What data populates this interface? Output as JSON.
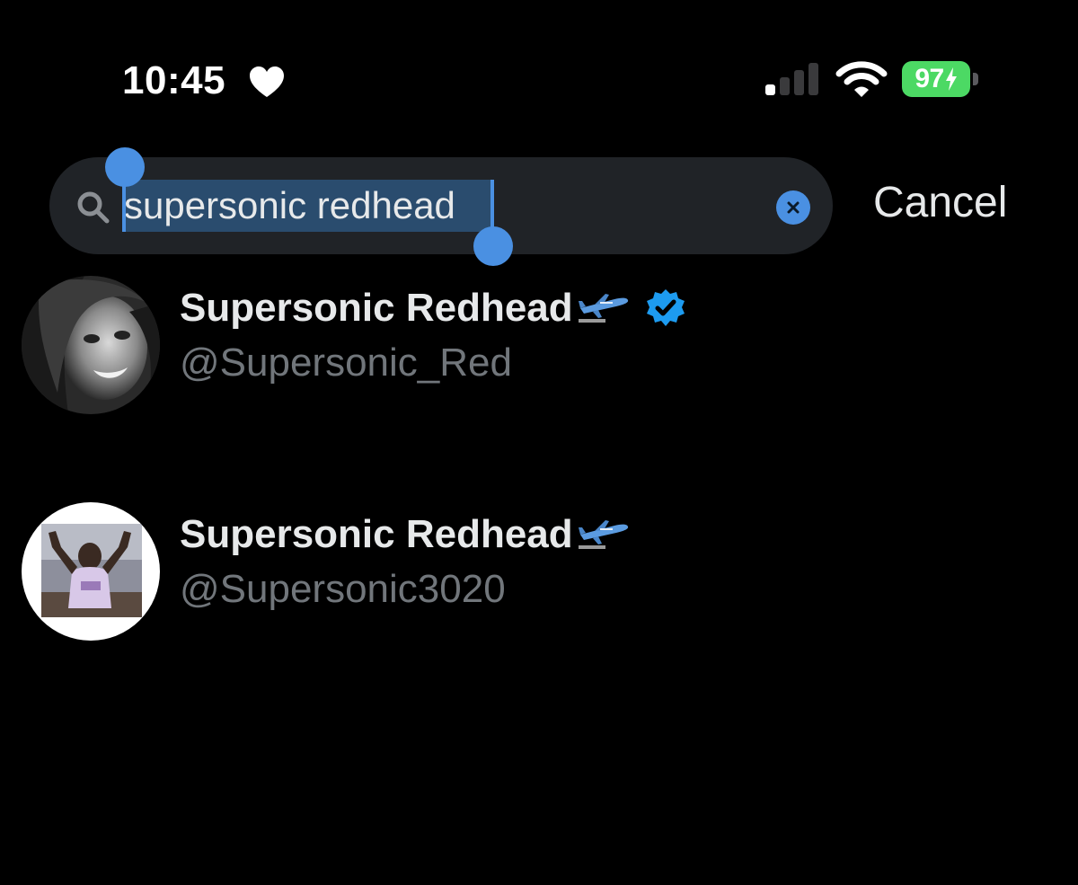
{
  "status_bar": {
    "time": "10:45",
    "battery_percent": "97",
    "cellular_bars_active": 1,
    "cellular_bars_total": 4
  },
  "search": {
    "query": "supersonic redhead",
    "selected_text": "supersonic redhead",
    "cancel_label": "Cancel"
  },
  "results": [
    {
      "display_name": "Supersonic Redhead",
      "name_emoji": "airplane-arriving-icon",
      "verified": true,
      "handle": "@Supersonic_Red"
    },
    {
      "display_name": "Supersonic Redhead",
      "name_emoji": "airplane-arriving-icon",
      "verified": false,
      "handle": "@Supersonic3020"
    }
  ],
  "colors": {
    "background": "#000000",
    "accent": "#4a90e2",
    "search_field": "#202327",
    "selection_highlight": "#2a4c6e",
    "battery_green": "#4cd964",
    "primary_text": "#e7e9ea",
    "secondary_text": "#71767b"
  }
}
